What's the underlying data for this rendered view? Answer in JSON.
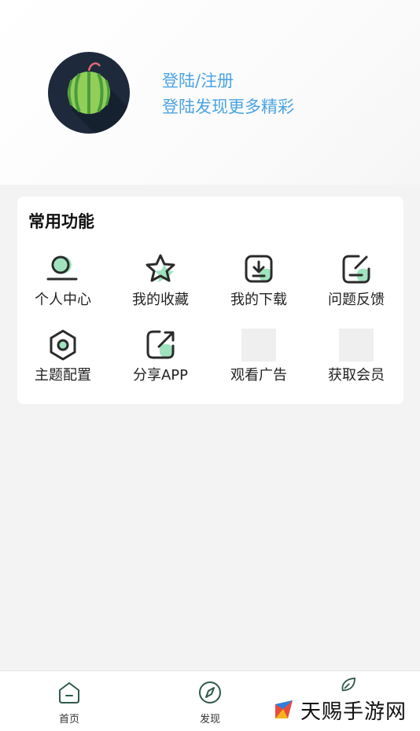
{
  "profile": {
    "login_title": "登陆/注册",
    "login_subtitle": "登陆发现更多精彩",
    "avatar_icon": "watermelon-icon"
  },
  "functions": {
    "title": "常用功能",
    "items": [
      {
        "label": "个人中心",
        "icon": "user-icon"
      },
      {
        "label": "我的收藏",
        "icon": "star-icon"
      },
      {
        "label": "我的下载",
        "icon": "download-icon"
      },
      {
        "label": "问题反馈",
        "icon": "edit-icon"
      },
      {
        "label": "主题配置",
        "icon": "hexagon-settings-icon"
      },
      {
        "label": "分享APP",
        "icon": "share-icon"
      },
      {
        "label": "观看广告",
        "icon": "image-placeholder-icon"
      },
      {
        "label": "获取会员",
        "icon": "image-placeholder-icon"
      }
    ]
  },
  "nav": {
    "items": [
      {
        "label": "首页",
        "icon": "home-icon"
      },
      {
        "label": "发现",
        "icon": "compass-icon"
      },
      {
        "label": "",
        "icon": "leaf-icon"
      }
    ]
  },
  "watermark": {
    "text": "天赐手游网"
  },
  "colors": {
    "accent": "#4ba3e3",
    "icon_green": "#9fe3bf",
    "icon_stroke": "#2b2b2b",
    "nav_green": "#2f5a4a"
  }
}
